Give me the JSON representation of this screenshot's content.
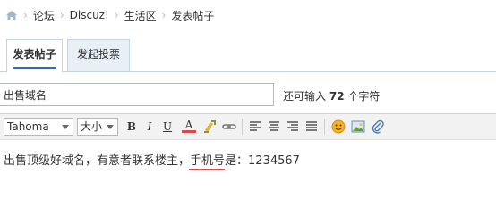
{
  "breadcrumb": {
    "items": [
      "论坛",
      "Discuz!",
      "生活区",
      "发表帖子"
    ],
    "separator": "›"
  },
  "tabs": [
    {
      "label": "发表帖子",
      "active": true
    },
    {
      "label": "发起投票",
      "active": false
    }
  ],
  "subject": {
    "value": "出售域名"
  },
  "char_counter": {
    "prefix": "还可输入",
    "count": "72",
    "suffix": "个字符"
  },
  "toolbar": {
    "font_family": "Tahoma",
    "font_size": "大小",
    "buttons": [
      "bold-icon",
      "italic-icon",
      "underline-icon",
      "font-color-icon",
      "background-color-icon",
      "link-icon",
      "align-left-icon",
      "align-center-icon",
      "align-right-icon",
      "align-justify-icon",
      "emoticon-icon",
      "image-icon",
      "attachment-icon"
    ],
    "bold": "B",
    "italic": "I",
    "underline": "U",
    "color": "A"
  },
  "editor": {
    "text_before": "出售顶级好域名，有意者联系楼主，",
    "text_highlight": "手机号",
    "text_after": "是：1234567"
  },
  "colors": {
    "border": "#c2d5e3",
    "tab_inactive_bg": "#e8eff5",
    "accent": "#2b6fb6",
    "highlight_underline": "#d94a4a"
  }
}
